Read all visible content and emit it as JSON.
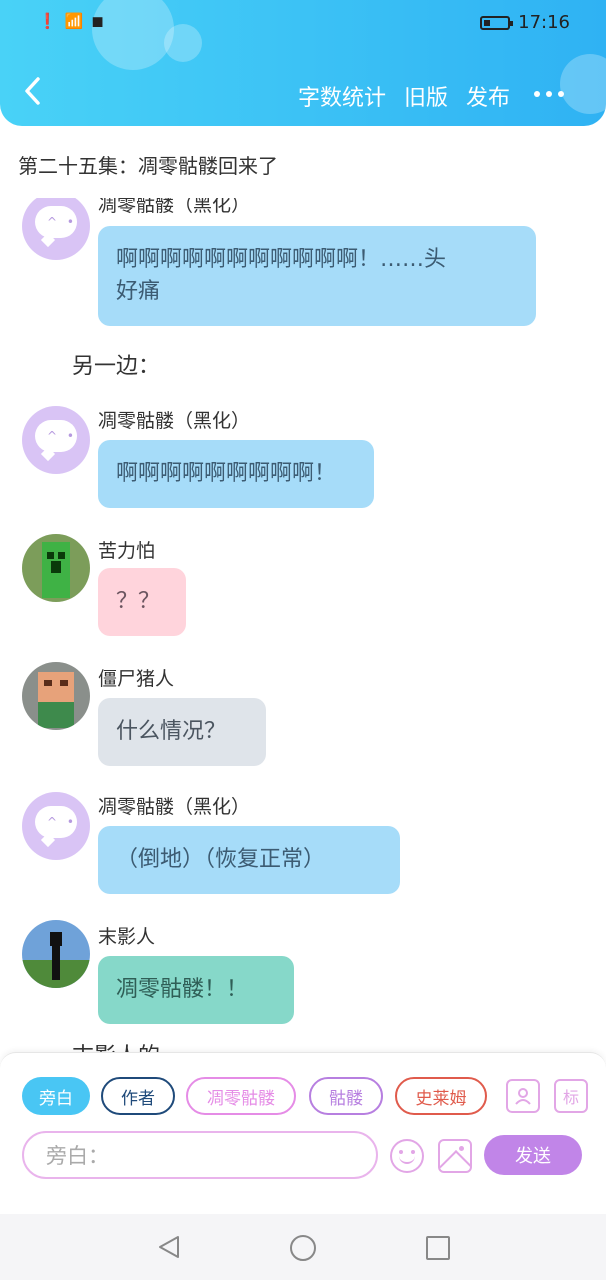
{
  "status_bar": {
    "time": "17:16"
  },
  "header": {
    "menu": [
      "字数统计",
      "旧版",
      "发布"
    ]
  },
  "episode_title": "第二十五集：凋零骷髅回来了",
  "chat": {
    "partial_top_name": "凋零骷髅（黑化）",
    "messages": [
      {
        "name": "",
        "text_line1": "啊啊啊啊啊啊啊啊啊啊啊！……头",
        "text_line2": "好痛"
      },
      {
        "narration": "另一边："
      },
      {
        "name": "凋零骷髅（黑化）",
        "text": "啊啊啊啊啊啊啊啊啊！"
      },
      {
        "name": "苦力怕",
        "text": "？？"
      },
      {
        "name": "僵尸猪人",
        "text": "什么情况？"
      },
      {
        "name": "凋零骷髅（黑化）",
        "text": "（倒地）（恢复正常）"
      },
      {
        "name": "末影人",
        "text": "凋零骷髅！！"
      }
    ],
    "partial_bottom_text": "末影人的"
  },
  "roles": [
    {
      "label": "旁白",
      "color": "#49c6f4",
      "filled": true
    },
    {
      "label": "作者",
      "color": "#1f4a7a",
      "filled": false
    },
    {
      "label": "凋零骷髅",
      "color": "#e58ce6",
      "filled": false
    },
    {
      "label": "骷髅",
      "color": "#b77fe0",
      "filled": false
    },
    {
      "label": "史莱姆",
      "color": "#e05b4c",
      "filled": false
    }
  ],
  "tag_icon_label": "标",
  "input": {
    "placeholder": "旁白："
  },
  "send_label": "发送"
}
